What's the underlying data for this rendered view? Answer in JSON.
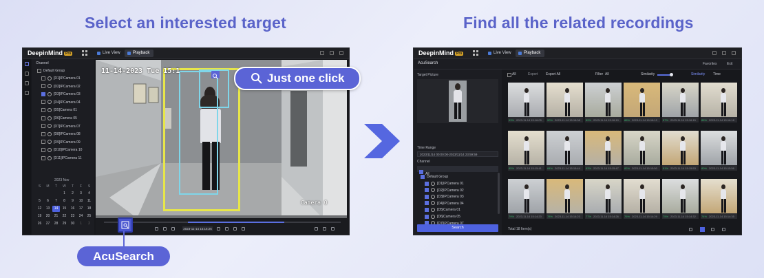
{
  "headings": {
    "left": "Select an interested target",
    "right": "Find all the related recordings"
  },
  "app": {
    "name": "DeepinMind",
    "badge": "Pro",
    "tabs": [
      "Live View",
      "Playback"
    ]
  },
  "left_panel": {
    "channel_label": "Channel",
    "group": "Default Group",
    "cameras": [
      "[D1]IPCamera 01",
      "[D2]IPCamera 02",
      "[D3]IPCamera 03",
      "[D4]IPCamera 04",
      "[D5]Camera 01",
      "[D6]Camera 05",
      "[D7]IPCamera 07",
      "[D8]IPCamera 08",
      "[D9]IPCamera 09",
      "[D10]IPCamera 10",
      "[D11]IPCamera 11"
    ],
    "calendar": {
      "month": "2023 Nov",
      "weekdays": [
        "S",
        "M",
        "T",
        "W",
        "T",
        "F",
        "S"
      ],
      "rows": [
        [
          "",
          "",
          "",
          "1",
          "2",
          "3",
          "4"
        ],
        [
          "5",
          "6",
          "7",
          "8",
          "9",
          "10",
          "11"
        ],
        [
          "12",
          "13",
          "14",
          "15",
          "16",
          "17",
          "18"
        ],
        [
          "19",
          "20",
          "21",
          "22",
          "23",
          "24",
          "25"
        ],
        [
          "26",
          "27",
          "28",
          "29",
          "30",
          "1",
          "2"
        ]
      ],
      "selected_day": "14"
    },
    "osd_time": "11-14-2023 Tue 15:1",
    "camera_label": "Camera 0",
    "playback_time": "2023-11-14 15:16:26"
  },
  "callouts": {
    "one_click": "Just one click",
    "acusearch": "AcuSearch"
  },
  "right_panel": {
    "section_title": "AcuSearch",
    "favorites": "Favorites",
    "exit": "Exit",
    "target_picture_label": "Target Picture",
    "time_range_label": "Time Range",
    "time_range_value": "2023/11/14 00:00:00-2023/11/14 23:59:59",
    "channel_label": "Channel",
    "all_label": "All",
    "group": "Default Group",
    "channels": [
      "[D1]IPCamera 01",
      "[D2]IPCamera 02",
      "[D3]IPCamera 03",
      "[D4]IPCamera 04",
      "[D5]Camera 01",
      "[D6]Camera 05",
      "[D7]IPCamera 07"
    ],
    "search_button": "Search",
    "toolbar": {
      "all": "All",
      "export": "Export",
      "export_all": "Export All",
      "filter": "Filter",
      "filter_value": "All",
      "similarity": "Similarity",
      "similarity_sort": "Similarity",
      "time": "Time"
    },
    "results_total": "Total 18 Item(s)",
    "results": [
      {
        "score": "93%",
        "time": "2023-11-14 15:16:05"
      },
      {
        "score": "90%",
        "time": "2023-11-14 15:16:08"
      },
      {
        "score": "89%",
        "time": "2023-11-14 15:16:10"
      },
      {
        "score": "88%",
        "time": "2023-11-14 15:16:12"
      },
      {
        "score": "87%",
        "time": "2023-11-14 15:16:15"
      },
      {
        "score": "86%",
        "time": "2023-11-14 15:16:18"
      },
      {
        "score": "85%",
        "time": "2023-11-14 15:15:41"
      },
      {
        "score": "84%",
        "time": "2023-11-14 15:15:44"
      },
      {
        "score": "83%",
        "time": "2023-11-14 15:15:47"
      },
      {
        "score": "82%",
        "time": "2023-11-14 15:15:50"
      },
      {
        "score": "81%",
        "time": "2023-11-14 15:15:53"
      },
      {
        "score": "80%",
        "time": "2023-11-14 15:15:56"
      },
      {
        "score": "79%",
        "time": "2023-11-14 15:14:20"
      },
      {
        "score": "78%",
        "time": "2023-11-14 15:14:23"
      },
      {
        "score": "77%",
        "time": "2023-11-14 15:14:26"
      },
      {
        "score": "76%",
        "time": "2023-11-14 15:14:29"
      },
      {
        "score": "75%",
        "time": "2023-11-14 15:14:32"
      },
      {
        "score": "74%",
        "time": "2023-11-14 15:14:35"
      }
    ]
  },
  "colors": {
    "accent": "#5b64d6",
    "heading": "#5a63c9",
    "arrow": "#5567e0",
    "box_yellow": "#e7e64a",
    "box_cyan": "#7fd6ea"
  }
}
